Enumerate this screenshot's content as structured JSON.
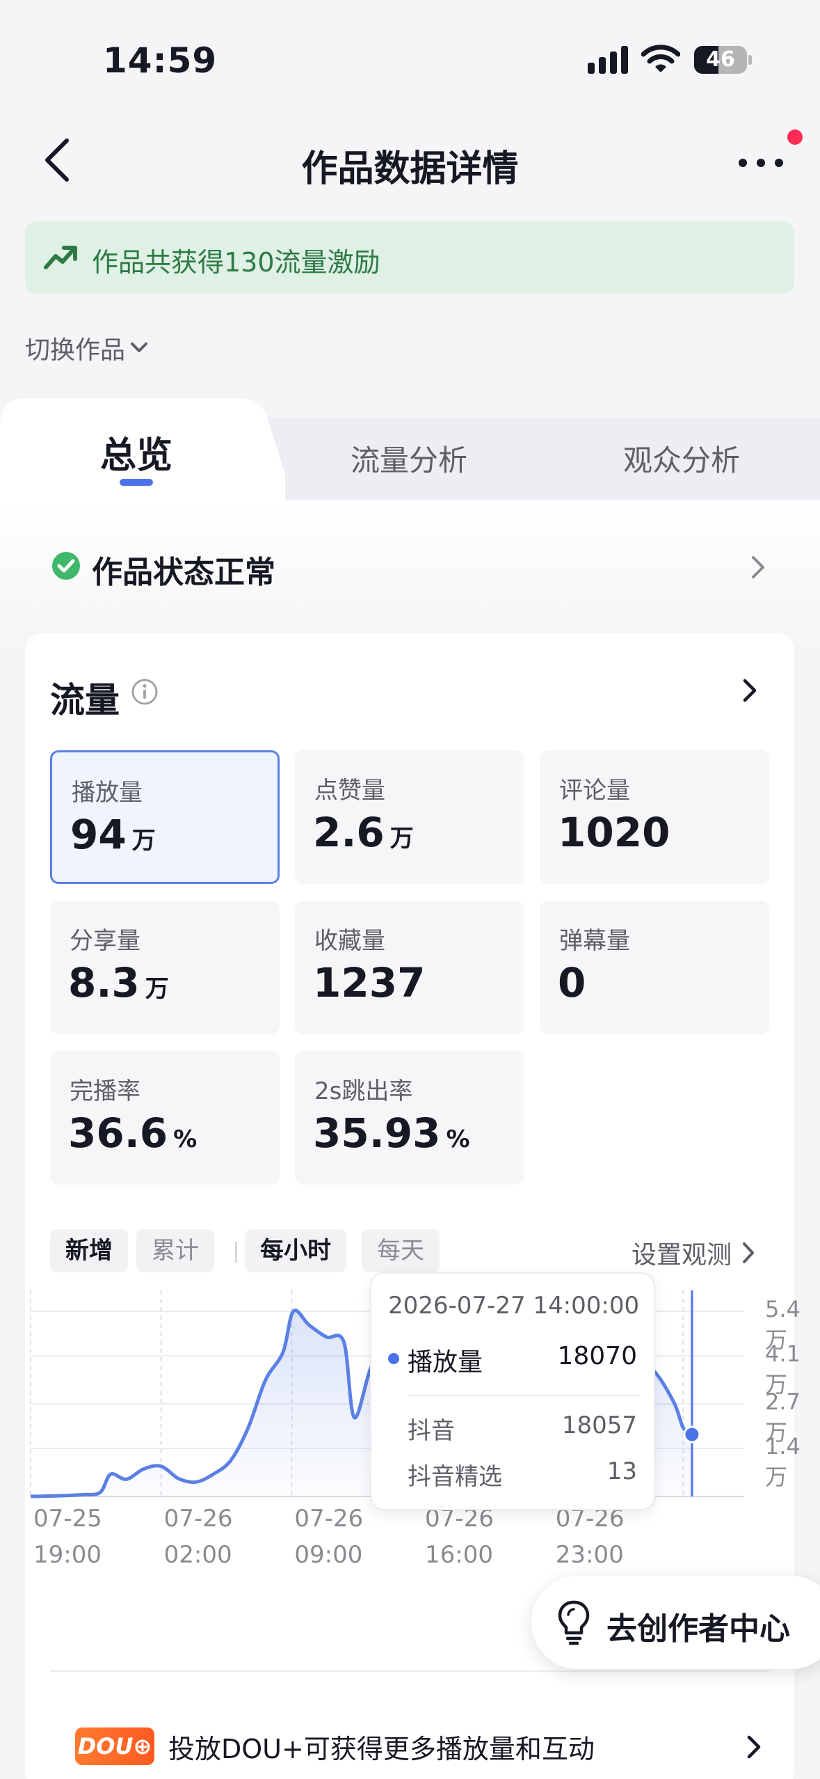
{
  "status_bar": {
    "time": "14:59",
    "battery": "46",
    "battery_level": 0.46
  },
  "nav": {
    "title": "作品数据详情"
  },
  "banner": {
    "text": "作品共获得130流量激励"
  },
  "switch_work": {
    "label": "切换作品"
  },
  "tabs": [
    {
      "label": "总览",
      "active": true
    },
    {
      "label": "流量分析",
      "active": false
    },
    {
      "label": "观众分析",
      "active": false
    }
  ],
  "work_status": {
    "label": "作品状态正常"
  },
  "traffic": {
    "title": "流量",
    "metrics": [
      {
        "label": "播放量",
        "value": "94",
        "unit": "万",
        "selected": true
      },
      {
        "label": "点赞量",
        "value": "2.6",
        "unit": "万"
      },
      {
        "label": "评论量",
        "value": "1020",
        "unit": ""
      },
      {
        "label": "分享量",
        "value": "8.3",
        "unit": "万"
      },
      {
        "label": "收藏量",
        "value": "1237",
        "unit": ""
      },
      {
        "label": "弹幕量",
        "value": "0",
        "unit": ""
      },
      {
        "label": "完播率",
        "value": "36.6",
        "unit": "%"
      },
      {
        "label": "2s跳出率",
        "value": "35.93",
        "unit": "%"
      }
    ],
    "chips": [
      {
        "label": "新增",
        "active": true
      },
      {
        "label": "累计",
        "active": false
      },
      {
        "label": "每小时",
        "active": true
      },
      {
        "label": "每天",
        "active": false
      }
    ],
    "observe_label": "设置观测"
  },
  "chart_data": {
    "type": "area",
    "x_tick_labels": [
      [
        "07-25",
        "19:00"
      ],
      [
        "07-26",
        "02:00"
      ],
      [
        "07-26",
        "09:00"
      ],
      [
        "07-26",
        "16:00"
      ],
      [
        "07-26",
        "23:00"
      ]
    ],
    "y_tick_labels": [
      "5.4万",
      "4.1万",
      "2.7万",
      "1.4万"
    ],
    "y_ticks": [
      54000,
      41000,
      27000,
      14000
    ],
    "ylim": [
      0,
      54000
    ],
    "hours_range": [
      0,
      41
    ],
    "series": [
      {
        "name": "播放量",
        "color": "#5b80e5",
        "points": [
          [
            0,
            0
          ],
          [
            1,
            100
          ],
          [
            2,
            250
          ],
          [
            3,
            500
          ],
          [
            4,
            1200
          ],
          [
            4.6,
            6500
          ],
          [
            5.5,
            5000
          ],
          [
            6.5,
            8000
          ],
          [
            7.5,
            8800
          ],
          [
            8.5,
            5200
          ],
          [
            9.5,
            4200
          ],
          [
            10.5,
            6500
          ],
          [
            11.5,
            10500
          ],
          [
            12.5,
            20000
          ],
          [
            13.5,
            34000
          ],
          [
            14.5,
            42000
          ],
          [
            15.1,
            54000
          ],
          [
            16,
            50000
          ],
          [
            17,
            46500
          ],
          [
            18,
            45000
          ],
          [
            18.6,
            23000
          ],
          [
            19.6,
            38000
          ],
          [
            20.5,
            38500
          ],
          [
            21.5,
            34000
          ],
          [
            23,
            30000
          ],
          [
            24.5,
            26000
          ],
          [
            26,
            22000
          ],
          [
            27.5,
            18000
          ],
          [
            28.5,
            12000
          ],
          [
            29.5,
            6000
          ],
          [
            30.5,
            5000
          ],
          [
            31.5,
            6500
          ],
          [
            32.5,
            13500
          ],
          [
            33.5,
            22000
          ],
          [
            34.5,
            33000
          ],
          [
            35.2,
            38500
          ],
          [
            36,
            35500
          ],
          [
            37,
            27000
          ],
          [
            37.5,
            20000
          ],
          [
            38,
            18070
          ]
        ]
      }
    ],
    "tooltip": {
      "time": "2026-07-27 14:00:00",
      "series_name": "播放量",
      "value": "18070",
      "breakdown": [
        {
          "label": "抖音",
          "value": "18057"
        },
        {
          "label": "抖音精选",
          "value": "13"
        }
      ]
    }
  },
  "float_button": {
    "label": "去创作者中心"
  },
  "dou_promo": {
    "badge": "DOU",
    "text": "投放DOU+可获得更多播放量和互动"
  }
}
